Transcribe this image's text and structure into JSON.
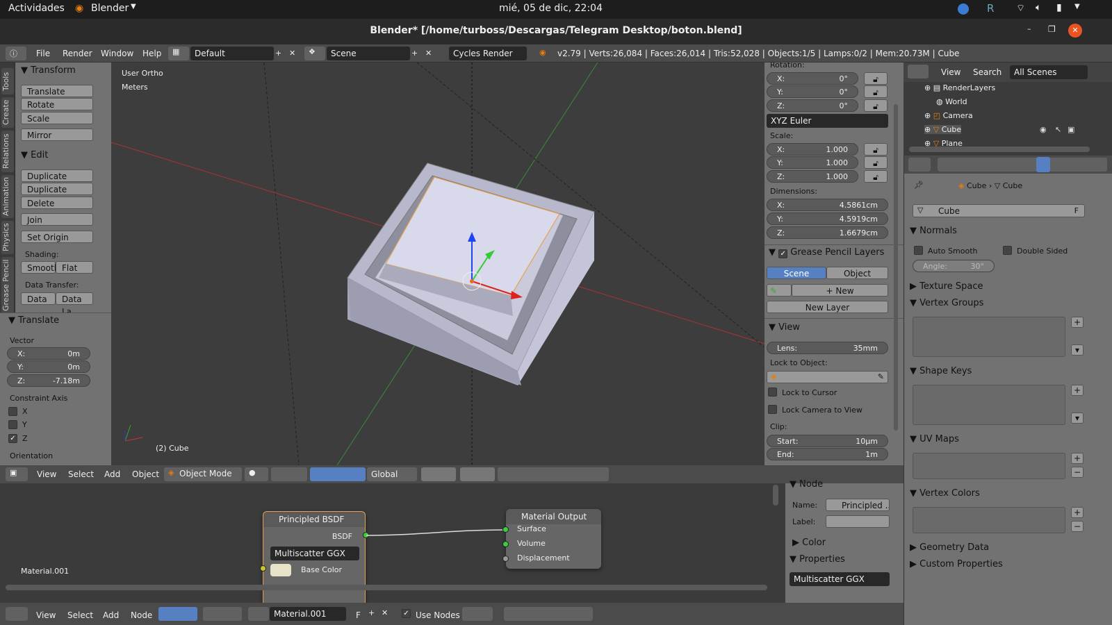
{
  "topbar": {
    "activities": "Actividades",
    "app": "Blender",
    "clock": "mié, 05 de dic, 22:04"
  },
  "window": {
    "title": "Blender* [/home/turboss/Descargas/Telegram Desktop/boton.blend]"
  },
  "menu": {
    "file": "File",
    "render": "Render",
    "window": "Window",
    "help": "Help"
  },
  "header": {
    "layout": "Default",
    "scene": "Scene",
    "engine": "Cycles Render",
    "stats": "v2.79 | Verts:26,084 | Faces:26,014 | Tris:52,028 | Objects:1/5 | Lamps:0/2 | Mem:20.73M | Cube"
  },
  "lefttabs": [
    "Tools",
    "Create",
    "Relations",
    "Animation",
    "Physics",
    "Grease Pencil"
  ],
  "toolshelf": {
    "transform_header": "Transform",
    "translate": "Translate",
    "rotate": "Rotate",
    "scale": "Scale",
    "mirror": "Mirror",
    "edit_header": "Edit",
    "duplicate": "Duplicate",
    "duplicate_linked": "Duplicate Linked",
    "delete": "Delete",
    "join": "Join",
    "set_origin": "Set Origin",
    "shading_label": "Shading:",
    "smooth": "Smooth",
    "flat": "Flat",
    "data_transfer_label": "Data Transfer:",
    "data": "Data",
    "data_la": "Data La"
  },
  "operator": {
    "header": "Translate",
    "vector_label": "Vector",
    "x_label": "X:",
    "x": "0m",
    "y_label": "Y:",
    "y": "0m",
    "z_label": "Z:",
    "z": "-7.18m",
    "constraint_label": "Constraint Axis",
    "cx": "X",
    "cy": "Y",
    "cz": "Z",
    "orientation_label": "Orientation"
  },
  "viewport": {
    "view_name": "User Ortho",
    "units": "Meters",
    "object_label": "(2) Cube"
  },
  "npanel": {
    "rotation_label": "Rotation:",
    "rx": "0°",
    "ry": "0°",
    "rz": "0°",
    "rot_mode": "XYZ Euler",
    "scale_label": "Scale:",
    "sx": "1.000",
    "sy": "1.000",
    "sz": "1.000",
    "dims_label": "Dimensions:",
    "dx": "4.5861cm",
    "dy": "4.5919cm",
    "dz": "1.6679cm",
    "gp_header": "Grease Pencil Layers",
    "gp_scene": "Scene",
    "gp_object": "Object",
    "gp_new": "New",
    "gp_new_layer": "New Layer",
    "view_header": "View",
    "lens_label": "Lens:",
    "lens": "35mm",
    "lock_object_label": "Lock to Object:",
    "lock_cursor": "Lock to Cursor",
    "lock_camera": "Lock Camera to View",
    "clip_label": "Clip:",
    "start_label": "Start:",
    "start": "10µm",
    "end_label": "End:",
    "end": "1m",
    "x_label": "X:",
    "y_label": "Y:",
    "z_label": "Z:"
  },
  "view3d_header": {
    "view": "View",
    "select": "Select",
    "add": "Add",
    "object": "Object",
    "mode": "Object Mode",
    "orientation": "Global"
  },
  "node_editor": {
    "material_label": "Material.001",
    "bsdf_title": "Principled BSDF",
    "bsdf_out": "BSDF",
    "bsdf_dist": "Multiscatter GGX",
    "base_color": "Base Color",
    "base_color_hex": "#e6e3c8",
    "output_title": "Material Output",
    "surface": "Surface",
    "volume": "Volume",
    "displacement": "Displacement"
  },
  "node_panel": {
    "node_header": "Node",
    "name_label": "Name:",
    "name_value": "Principled ...",
    "label_label": "Label:",
    "color_header": "Color",
    "properties_header": "Properties",
    "dist": "Multiscatter GGX"
  },
  "node_header": {
    "view": "View",
    "select": "Select",
    "add": "Add",
    "node": "Node",
    "material": "Material.001",
    "fake": "F",
    "use_nodes": "Use Nodes"
  },
  "outliner": {
    "view": "View",
    "search": "Search",
    "filter": "All Scenes",
    "items": [
      "RenderLayers",
      "World",
      "Camera",
      "Cube",
      "Plane"
    ]
  },
  "props": {
    "crumb_object": "Cube",
    "crumb_mesh": "Cube",
    "mesh_name": "Cube",
    "fake": "F",
    "normals_header": "Normals",
    "auto_smooth": "Auto Smooth",
    "double_sided": "Double Sided",
    "angle_label": "Angle:",
    "angle": "30°",
    "texture_space": "Texture Space",
    "vertex_groups": "Vertex Groups",
    "shape_keys": "Shape Keys",
    "uv_maps": "UV Maps",
    "vertex_colors": "Vertex Colors",
    "geometry_data": "Geometry Data",
    "custom_properties": "Custom Properties"
  },
  "colors": {
    "accent_blue": "#5680c2",
    "x_axis": "#c03030",
    "y_axis": "#5a9a3a",
    "selection": "#e8a050"
  }
}
